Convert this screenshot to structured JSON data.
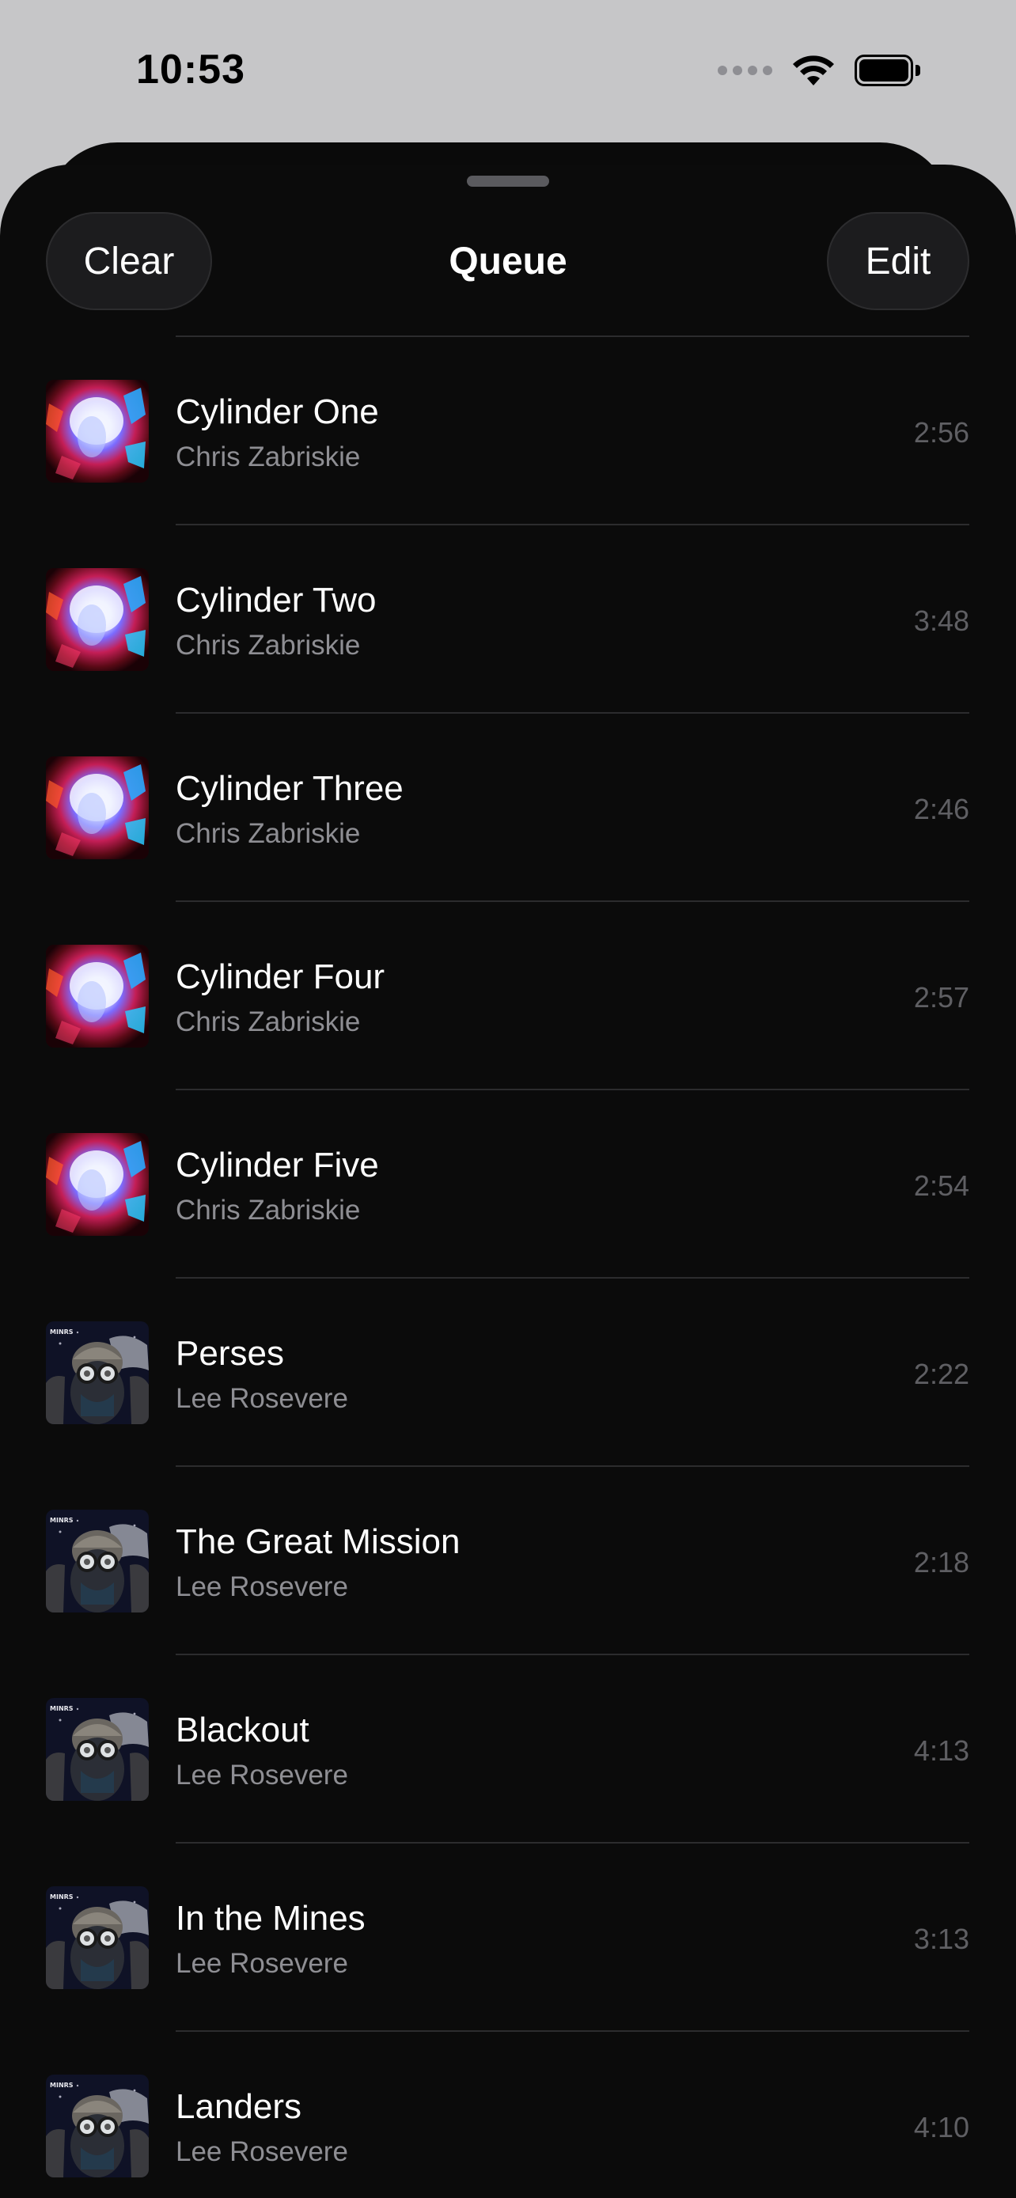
{
  "status_bar": {
    "time": "10:53",
    "icons": [
      "signal-dots-icon",
      "wifi-icon",
      "battery-icon"
    ]
  },
  "header": {
    "title": "Queue",
    "clear_label": "Clear",
    "edit_label": "Edit"
  },
  "artwork_styles": {
    "cylinder": "cosmic-nebula",
    "minrs": "robot-helmet"
  },
  "queue": [
    {
      "title": "Cylinder One",
      "artist": "Chris Zabriskie",
      "duration": "2:56",
      "artwork": "cylinder"
    },
    {
      "title": "Cylinder Two",
      "artist": "Chris Zabriskie",
      "duration": "3:48",
      "artwork": "cylinder"
    },
    {
      "title": "Cylinder Three",
      "artist": "Chris Zabriskie",
      "duration": "2:46",
      "artwork": "cylinder"
    },
    {
      "title": "Cylinder Four",
      "artist": "Chris Zabriskie",
      "duration": "2:57",
      "artwork": "cylinder"
    },
    {
      "title": "Cylinder Five",
      "artist": "Chris Zabriskie",
      "duration": "2:54",
      "artwork": "cylinder"
    },
    {
      "title": "Perses",
      "artist": "Lee Rosevere",
      "duration": "2:22",
      "artwork": "minrs"
    },
    {
      "title": "The Great Mission",
      "artist": "Lee Rosevere",
      "duration": "2:18",
      "artwork": "minrs"
    },
    {
      "title": "Blackout",
      "artist": "Lee Rosevere",
      "duration": "4:13",
      "artwork": "minrs"
    },
    {
      "title": "In the Mines",
      "artist": "Lee Rosevere",
      "duration": "3:13",
      "artwork": "minrs"
    },
    {
      "title": "Landers",
      "artist": "Lee Rosevere",
      "duration": "4:10",
      "artwork": "minrs"
    }
  ]
}
